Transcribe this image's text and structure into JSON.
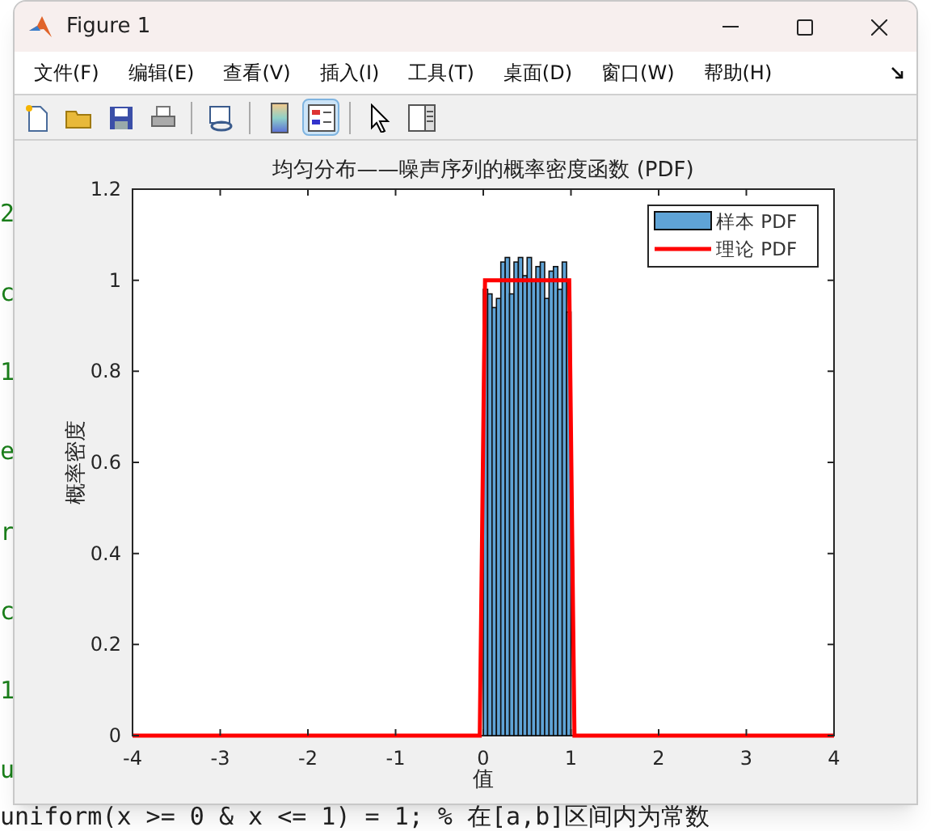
{
  "editor": {
    "fragments": [
      "2",
      "c",
      "1",
      "e",
      "r",
      "c",
      "1",
      "u"
    ],
    "bottom_line": "uniform(x >= 0 & x <= 1) = 1; % 在[a,b]区间内为常数"
  },
  "window": {
    "title": "Figure 1"
  },
  "menu": [
    "文件(F)",
    "编辑(E)",
    "查看(V)",
    "插入(I)",
    "工具(T)",
    "桌面(D)",
    "窗口(W)",
    "帮助(H)"
  ],
  "toolbar": [
    {
      "kind": "new",
      "selected": false
    },
    {
      "kind": "open",
      "selected": false
    },
    {
      "kind": "save",
      "selected": false
    },
    {
      "kind": "print",
      "selected": false
    },
    {
      "kind": "separator"
    },
    {
      "kind": "link",
      "selected": false
    },
    {
      "kind": "separator"
    },
    {
      "kind": "colorbar",
      "selected": false
    },
    {
      "kind": "legend",
      "selected": true
    },
    {
      "kind": "separator"
    },
    {
      "kind": "pointer",
      "selected": false
    },
    {
      "kind": "property",
      "selected": false
    }
  ],
  "plot": {
    "chart_data": {
      "type": "bar",
      "title": "均匀分布——噪声序列的概率密度函数 (PDF)",
      "xlabel": "值",
      "ylabel": "概率密度",
      "xlim": [
        -4,
        4
      ],
      "ylim": [
        0,
        1.2
      ],
      "legend": true,
      "xticks": [
        -4,
        -3,
        -2,
        -1,
        0,
        1,
        2,
        3,
        4
      ],
      "yticks": [
        0,
        0.2,
        0.4,
        0.6,
        0.8,
        1,
        1.2
      ],
      "series": [
        {
          "name": "样本 PDF",
          "color": "#5fa3d6",
          "x": [
            0.025,
            0.075,
            0.125,
            0.175,
            0.225,
            0.275,
            0.325,
            0.375,
            0.425,
            0.475,
            0.525,
            0.575,
            0.625,
            0.675,
            0.725,
            0.775,
            0.825,
            0.875,
            0.925,
            0.975
          ],
          "values": [
            0.98,
            0.97,
            0.94,
            0.96,
            1.04,
            1.05,
            0.97,
            1.04,
            1.05,
            1.01,
            1.05,
            1.0,
            1.03,
            1.04,
            0.96,
            1.02,
            1.03,
            0.98,
            1.04,
            0.93
          ]
        },
        {
          "name": "理论 PDF",
          "type": "line",
          "color": "#ff0000",
          "x": [
            -4,
            -0.04,
            0.02,
            0.98,
            1.04,
            4
          ],
          "values": [
            0,
            0,
            1,
            1,
            0,
            0
          ]
        }
      ]
    }
  }
}
